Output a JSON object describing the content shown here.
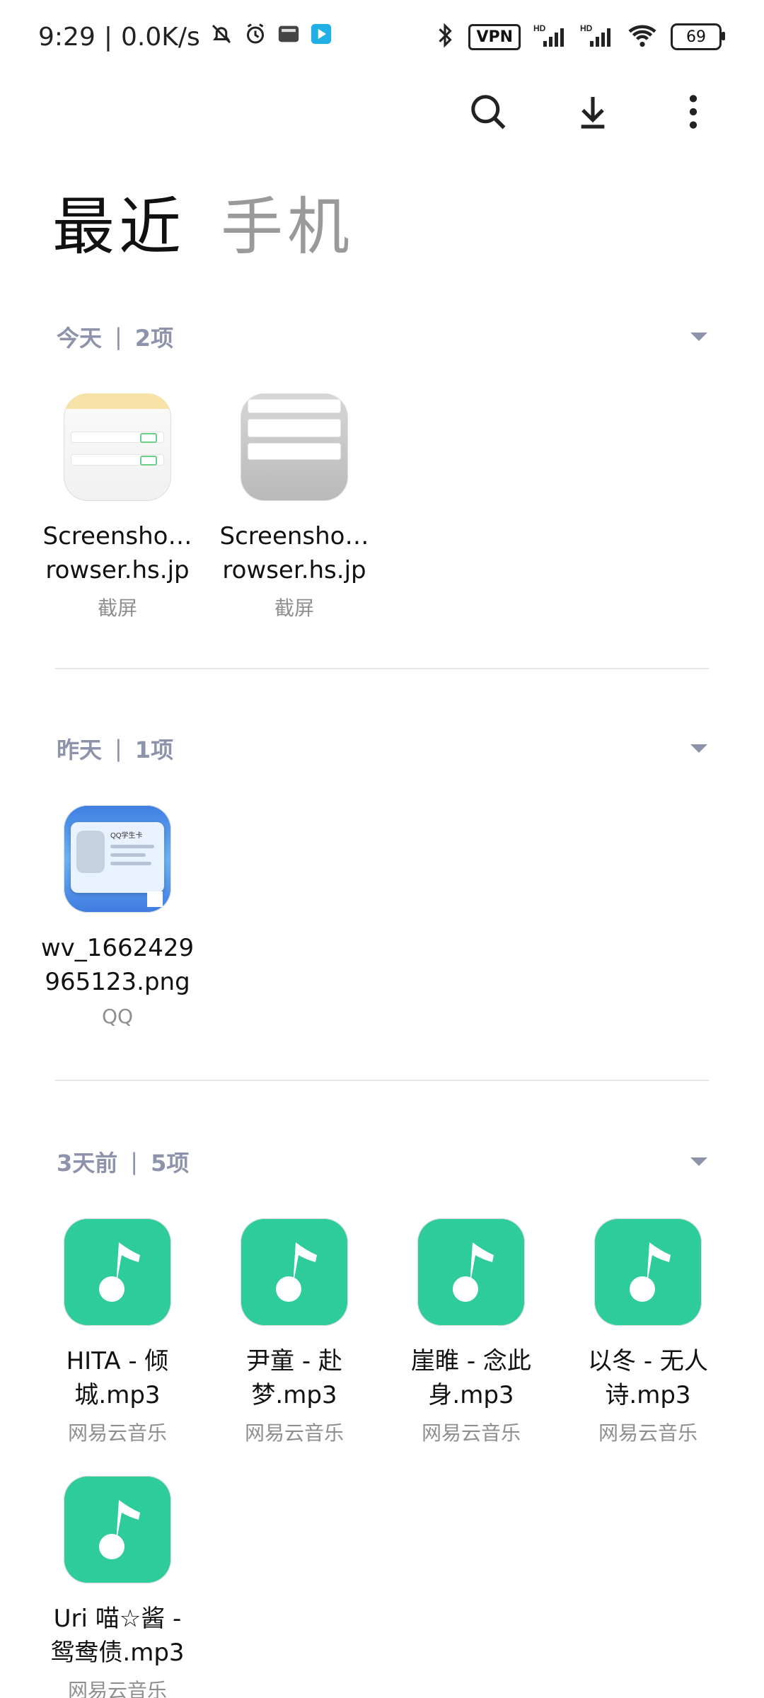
{
  "status_bar": {
    "time": "9:29",
    "separator": "|",
    "network_speed": "0.0K/s",
    "vpn": "VPN",
    "hd1": "HD",
    "hd2": "HD",
    "battery": "69"
  },
  "tabs": [
    {
      "label": "最近",
      "active": true
    },
    {
      "label": "手机",
      "active": false
    }
  ],
  "sections": [
    {
      "title": "今天",
      "sep": "|",
      "count": "2项",
      "items": [
        {
          "name_line1": "Screensho…",
          "name_line2": "rowser.hs.jp",
          "source": "截屏",
          "type": "screenshot-light"
        },
        {
          "name_line1": "Screensho…",
          "name_line2": "rowser.hs.jp",
          "source": "截屏",
          "type": "screenshot-dark"
        }
      ]
    },
    {
      "title": "昨天",
      "sep": "|",
      "count": "1项",
      "items": [
        {
          "name_line1": "wv_1662429",
          "name_line2": "965123.png",
          "source": "QQ",
          "type": "qq-image"
        }
      ]
    },
    {
      "title": "3天前",
      "sep": "|",
      "count": "5项",
      "items": [
        {
          "name_line1": "HITA - 倾",
          "name_line2": "城.mp3",
          "source": "网易云音乐",
          "type": "music"
        },
        {
          "name_line1": "尹童 - 赴",
          "name_line2": "梦.mp3",
          "source": "网易云音乐",
          "type": "music"
        },
        {
          "name_line1": "崖睢 - 念此",
          "name_line2": "身.mp3",
          "source": "网易云音乐",
          "type": "music"
        },
        {
          "name_line1": "以冬 - 无人",
          "name_line2": "诗.mp3",
          "source": "网易云音乐",
          "type": "music"
        },
        {
          "name_line1": "Uri 喵☆酱 -",
          "name_line2": "鸳鸯债.mp3",
          "source": "网易云音乐",
          "type": "music"
        }
      ]
    }
  ],
  "thumb_text": {
    "qq_card_title": "QQ学生卡"
  },
  "colors": {
    "music_accent": "#2ecc9a",
    "section_header": "#8d93aa"
  }
}
